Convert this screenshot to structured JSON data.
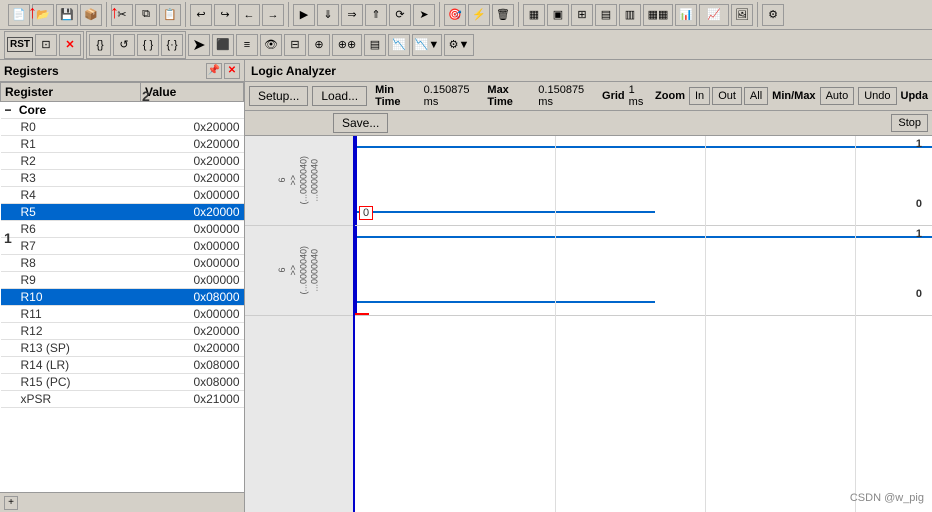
{
  "toolbar1": {
    "buttons": [
      "new",
      "open",
      "save",
      "project",
      "cut",
      "copy",
      "paste",
      "undo",
      "redo",
      "back",
      "forward",
      "run",
      "stop-dbg",
      "reset",
      "step",
      "over",
      "out",
      "jump",
      "arrow-right",
      "target",
      "flash",
      "erase",
      "download",
      "layout1",
      "layout2",
      "layout3",
      "layout4",
      "layout5",
      "layout6",
      "layout7",
      "layout8",
      "layout9",
      "settings"
    ]
  },
  "toolbar2": {
    "rst_label": "RST",
    "buttons": [
      "reg-window",
      "close-red",
      "braces-open",
      "braces-loop",
      "braces-empty",
      "braces-curly",
      "arrow-right2",
      "terminal",
      "mem-map",
      "watch",
      "stack",
      "trace",
      "trace2",
      "trace3",
      "trace4",
      "trace5",
      "settings2"
    ]
  },
  "registers": {
    "panel_title": "Registers",
    "col_register": "Register",
    "col_value": "Value",
    "annotation_1": "1",
    "annotation_2": "2",
    "group_core": "Core",
    "rows": [
      {
        "name": "R0",
        "value": "0x20000",
        "selected": false
      },
      {
        "name": "R1",
        "value": "0x20000",
        "selected": false
      },
      {
        "name": "R2",
        "value": "0x20000",
        "selected": false
      },
      {
        "name": "R3",
        "value": "0x20000",
        "selected": false
      },
      {
        "name": "R4",
        "value": "0x00000",
        "selected": false
      },
      {
        "name": "R5",
        "value": "0x20000",
        "selected": true
      },
      {
        "name": "R6",
        "value": "0x00000",
        "selected": false
      },
      {
        "name": "R7",
        "value": "0x00000",
        "selected": false
      },
      {
        "name": "R8",
        "value": "0x00000",
        "selected": false
      },
      {
        "name": "R9",
        "value": "0x00000",
        "selected": false
      },
      {
        "name": "R10",
        "value": "0x08000",
        "selected": true
      },
      {
        "name": "R11",
        "value": "0x00000",
        "selected": false
      },
      {
        "name": "R12",
        "value": "0x20000",
        "selected": false
      },
      {
        "name": "R13 (SP)",
        "value": "0x20000",
        "selected": false
      },
      {
        "name": "R14 (LR)",
        "value": "0x08000",
        "selected": false
      },
      {
        "name": "R15 (PC)",
        "value": "0x08000",
        "selected": false
      },
      {
        "name": "xPSR",
        "value": "0x21000",
        "selected": false
      }
    ]
  },
  "logic_analyzer": {
    "title": "Logic Analyzer",
    "btn_setup": "Setup...",
    "btn_load": "Load...",
    "btn_save": "Save...",
    "min_time_label": "Min Time",
    "min_time_value": "0.150875 ms",
    "max_time_label": "Max Time",
    "max_time_value": "0.150875 ms",
    "grid_label": "Grid",
    "grid_value": "1 ms",
    "zoom_label": "Zoom",
    "zoom_in": "In",
    "zoom_out": "Out",
    "zoom_all": "All",
    "minmax_label": "Min/Max",
    "auto_btn": "Auto",
    "undo_btn": "Undo",
    "update_label": "Upda",
    "stop_btn": "Stop",
    "signals": [
      {
        "axis_text": "6 >> (0x...0000040)...0000040",
        "wave_high_val": "1",
        "wave_low_val": "0",
        "cursor_val": "0"
      },
      {
        "axis_text": "6 >> (0x...0000040)...0000040",
        "wave_high_val": "1",
        "wave_low_val": "0",
        "cursor_val": ""
      }
    ]
  },
  "watermark": "CSDN @w_pig"
}
